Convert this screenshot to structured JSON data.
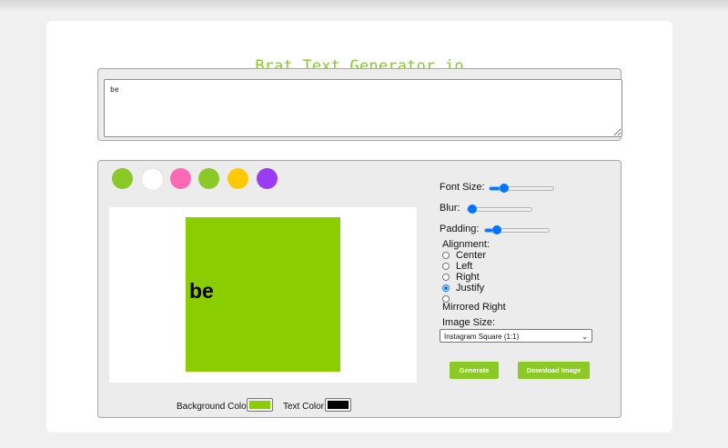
{
  "app": {
    "title": "Brat Text Generator.io"
  },
  "text_input": {
    "value": "be"
  },
  "swatches": [
    {
      "name": "green",
      "color": "#8ac926"
    },
    {
      "name": "white",
      "color": "#ffffff"
    },
    {
      "name": "pink",
      "color": "#ff69b4"
    },
    {
      "name": "green-2",
      "color": "#8ac926"
    },
    {
      "name": "yellow",
      "color": "#ffca05"
    },
    {
      "name": "purple",
      "color": "#9b3cf5"
    }
  ],
  "preview": {
    "text": "be",
    "background_color": "#8acd00",
    "text_color": "#000000"
  },
  "colors": {
    "background_label": "Background Color:",
    "text_label": "Text Color:"
  },
  "settings": {
    "font_size_label": "Font Size:",
    "font_size_level": 0.15,
    "blur_label": "Blur:",
    "blur_level": 0.0,
    "padding_label": "Padding:",
    "padding_level": 0.12,
    "alignment_label": "Alignment:",
    "alignment_options": [
      "Center",
      "Left",
      "Right",
      "Justify",
      "Mirrored Right"
    ],
    "alignment_selected": "Justify",
    "image_size_label": "Image Size:",
    "image_size_value": "Instagram Square (1:1)"
  },
  "buttons": {
    "generate": "Generate",
    "download": "Download Image"
  },
  "theme": {
    "accent": "#8ac926",
    "slider": "#0075ff"
  }
}
